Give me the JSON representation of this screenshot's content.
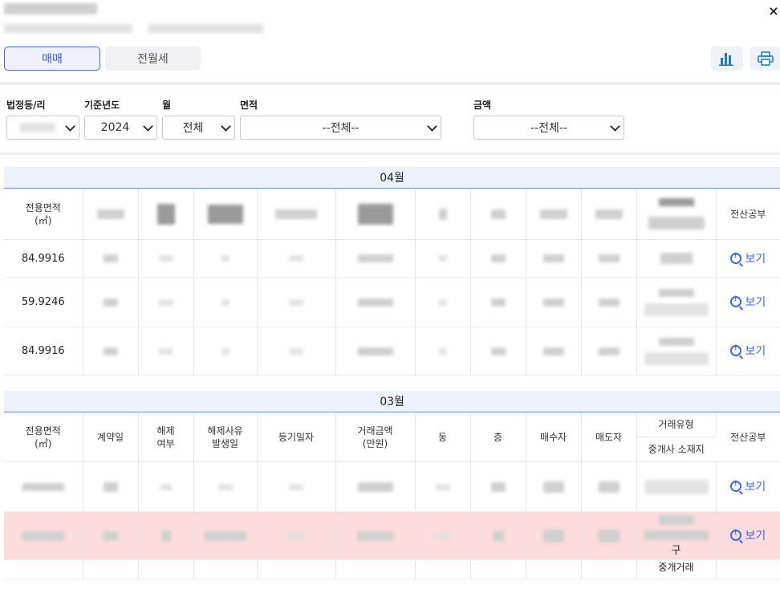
{
  "header": {
    "close_label": "×"
  },
  "tabs": [
    {
      "label": "매매",
      "active": true
    },
    {
      "label": "전월세",
      "active": false
    }
  ],
  "toolbar": {
    "chart_icon": "bar-chart-icon",
    "print_icon": "printer-icon"
  },
  "filters": {
    "dong_label": "법정동/리",
    "year_label": "기준년도",
    "year_value": "2024",
    "month_label": "월",
    "month_value": "전체",
    "area_label": "면적",
    "area_value": "--전체--",
    "amount_label": "금액",
    "amount_value": "--전체--"
  },
  "columns": {
    "area": "전용면적\n(㎡)",
    "contract_date": "계약일",
    "cancel": "해제\n여부",
    "cancel_date": "해제사유\n발생일",
    "reg_date": "등기일자",
    "amount": "거래금액\n(만원)",
    "dong": "동",
    "floor": "층",
    "buyer": "매수자",
    "seller": "매도자",
    "trade_type": "거래유형",
    "broker_loc": "중개사 소재지",
    "ledger": "전산공부"
  },
  "sections": [
    {
      "month": "04월",
      "rows": [
        {
          "area": "84.9916",
          "view": "보기"
        },
        {
          "area": "59.9246",
          "view": "보기"
        },
        {
          "area": "84.9916",
          "view": "보기"
        }
      ]
    },
    {
      "month": "03월",
      "rows": [
        {
          "view": "보기",
          "highlight": false
        },
        {
          "view": "보기",
          "highlight": true,
          "broker_tail": "구"
        }
      ],
      "partial_row_text": "중개거래"
    }
  ],
  "colors": {
    "accent": "#3b5bd6",
    "highlight_row": "#fcdcdc",
    "month_bar": "#eef2fc"
  }
}
